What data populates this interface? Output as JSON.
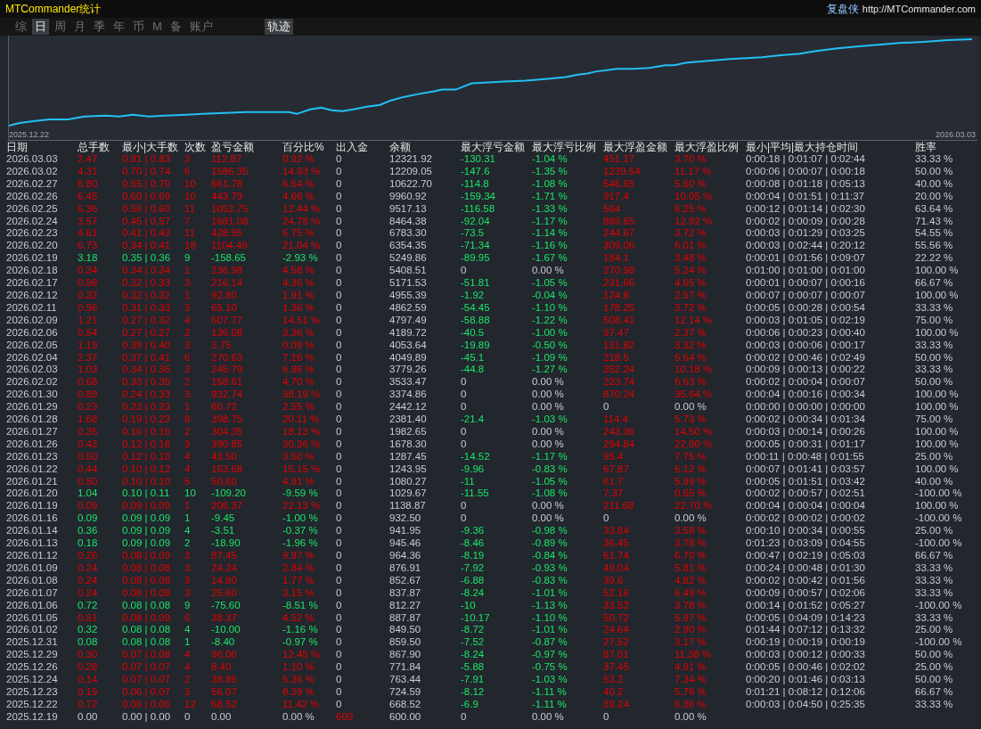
{
  "window": {
    "title": "MTCommander统计",
    "brand": "复盘侠",
    "url": "http://MTCommander.com"
  },
  "tabs": [
    {
      "label": "综",
      "selected": false
    },
    {
      "label": "日",
      "selected": true
    },
    {
      "label": "周",
      "selected": false
    },
    {
      "label": "月",
      "selected": false
    },
    {
      "label": "季",
      "selected": false
    },
    {
      "label": "年",
      "selected": false
    },
    {
      "label": "币",
      "selected": false
    },
    {
      "label": "M",
      "selected": false
    },
    {
      "label": "备",
      "selected": false
    },
    {
      "label": "账户",
      "selected": false
    }
  ],
  "view_tab": {
    "label": "轨迹",
    "selected": true
  },
  "chart": {
    "start_label": "2025.12.22",
    "end_label": "2026.03.03"
  },
  "columns": [
    "日期",
    "总手数",
    "最小|大手数",
    "次数",
    "盈亏金额",
    "百分比%",
    "出入金",
    "余额",
    "最大浮亏金额",
    "最大浮亏比例",
    "最大浮盈金额",
    "最大浮盈比例",
    "最小|平均|最大持仓时间",
    "胜率"
  ],
  "rows": [
    {
      "profit": true,
      "loss": false,
      "drawdown": true,
      "runup": true,
      "deposit": false,
      "cells": [
        "2026.03.03",
        "2.47",
        "0.81 | 0.83",
        "3",
        "112.87",
        "0.92 %",
        "0",
        "12321.92",
        "-130.31",
        "-1.04 %",
        "451.17",
        "3.70 %",
        "0:00:18 | 0:01:07 | 0:02:44",
        "33.33 %"
      ]
    },
    {
      "profit": true,
      "loss": false,
      "drawdown": true,
      "runup": true,
      "deposit": false,
      "cells": [
        "2026.03.02",
        "4.31",
        "0.70 | 0.74",
        "6",
        "1586.35",
        "14.93 %",
        "0",
        "12209.05",
        "-147.6",
        "-1.35 %",
        "1239.54",
        "11.17 %",
        "0:00:06 | 0:00:07 | 0:00:18",
        "50.00 %"
      ]
    },
    {
      "profit": true,
      "loss": false,
      "drawdown": true,
      "runup": true,
      "deposit": false,
      "cells": [
        "2026.02.27",
        "6.80",
        "0.65 | 0.70",
        "10",
        "661.78",
        "6.64 %",
        "0",
        "10622.70",
        "-114.8",
        "-1.08 %",
        "546.65",
        "5.60 %",
        "0:00:08 | 0:01:18 | 0:05:13",
        "40.00 %"
      ]
    },
    {
      "profit": true,
      "loss": false,
      "drawdown": true,
      "runup": true,
      "deposit": false,
      "cells": [
        "2026.02.26",
        "6.45",
        "0.60 | 0.69",
        "10",
        "443.79",
        "4.66 %",
        "0",
        "9960.92",
        "-159.34",
        "-1.71 %",
        "917.4",
        "10.05 %",
        "0:00:04 | 0:01:51 | 0:11:37",
        "20.00 %"
      ]
    },
    {
      "profit": true,
      "loss": false,
      "drawdown": true,
      "runup": true,
      "deposit": false,
      "cells": [
        "2026.02.25",
        "6.36",
        "0.56 | 0.60",
        "11",
        "1052.75",
        "12.44 %",
        "0",
        "9517.13",
        "-116.58",
        "-1.33 %",
        "564",
        "6.25 %",
        "0:00:12 | 0:01:14 | 0:02:30",
        "63.64 %"
      ]
    },
    {
      "profit": true,
      "loss": false,
      "drawdown": true,
      "runup": true,
      "deposit": false,
      "cells": [
        "2026.02.24",
        "3.57",
        "0.45 | 0.57",
        "7",
        "1681.08",
        "24.78 %",
        "0",
        "8464.38",
        "-92.04",
        "-1.17 %",
        "889.65",
        "12.92 %",
        "0:00:02 | 0:00:09 | 0:00:28",
        "71.43 %"
      ]
    },
    {
      "profit": true,
      "loss": false,
      "drawdown": true,
      "runup": true,
      "deposit": false,
      "cells": [
        "2026.02.23",
        "4.61",
        "0.41 | 0.43",
        "11",
        "428.95",
        "6.75 %",
        "0",
        "6783.30",
        "-73.5",
        "-1.14 %",
        "244.67",
        "3.72 %",
        "0:00:03 | 0:01:29 | 0:03:25",
        "54.55 %"
      ]
    },
    {
      "profit": true,
      "loss": false,
      "drawdown": true,
      "runup": true,
      "deposit": false,
      "cells": [
        "2026.02.20",
        "6.73",
        "0.34 | 0.41",
        "18",
        "1104.49",
        "21.04 %",
        "0",
        "6354.35",
        "-71.34",
        "-1.16 %",
        "309.06",
        "6.01 %",
        "0:00:03 | 0:02:44 | 0:20:12",
        "55.56 %"
      ]
    },
    {
      "profit": false,
      "loss": true,
      "drawdown": true,
      "runup": true,
      "deposit": false,
      "cells": [
        "2026.02.19",
        "3.18",
        "0.35 | 0.36",
        "9",
        "-158.65",
        "-2.93 %",
        "0",
        "5249.86",
        "-89.95",
        "-1.67 %",
        "184.1",
        "3.48 %",
        "0:00:01 | 0:01:56 | 0:09:07",
        "22.22 %"
      ]
    },
    {
      "profit": true,
      "loss": false,
      "drawdown": false,
      "runup": true,
      "deposit": false,
      "cells": [
        "2026.02.18",
        "0.34",
        "0.34 | 0.34",
        "1",
        "236.98",
        "4.58 %",
        "0",
        "5408.51",
        "0",
        "0.00 %",
        "270.98",
        "5.24 %",
        "0:01:00 | 0:01:00 | 0:01:00",
        "100.00 %"
      ]
    },
    {
      "profit": true,
      "loss": false,
      "drawdown": true,
      "runup": true,
      "deposit": false,
      "cells": [
        "2026.02.17",
        "0.98",
        "0.32 | 0.33",
        "3",
        "216.14",
        "4.36 %",
        "0",
        "5171.53",
        "-51.81",
        "-1.05 %",
        "231.66",
        "4.65 %",
        "0:00:01 | 0:00:07 | 0:00:16",
        "66.67 %"
      ]
    },
    {
      "profit": true,
      "loss": false,
      "drawdown": true,
      "runup": true,
      "deposit": false,
      "cells": [
        "2026.02.12",
        "0.32",
        "0.32 | 0.32",
        "1",
        "92.80",
        "1.91 %",
        "0",
        "4955.39",
        "-1.92",
        "-0.04 %",
        "124.8",
        "2.57 %",
        "0:00:07 | 0:00:07 | 0:00:07",
        "100.00 %"
      ]
    },
    {
      "profit": true,
      "loss": false,
      "drawdown": true,
      "runup": true,
      "deposit": false,
      "cells": [
        "2026.02.11",
        "0.96",
        "0.31 | 0.33",
        "3",
        "65.10",
        "1.36 %",
        "0",
        "4862.59",
        "-54.45",
        "-1.10 %",
        "178.25",
        "3.72 %",
        "0:00:05 | 0:00:28 | 0:00:54",
        "33.33 %"
      ]
    },
    {
      "profit": true,
      "loss": false,
      "drawdown": true,
      "runup": true,
      "deposit": false,
      "cells": [
        "2026.02.09",
        "1.21",
        "0.27 | 0.32",
        "4",
        "607.77",
        "14.51 %",
        "0",
        "4797.49",
        "-58.88",
        "-1.22 %",
        "508.41",
        "12.14 %",
        "0:00:03 | 0:01:05 | 0:02:19",
        "75.00 %"
      ]
    },
    {
      "profit": true,
      "loss": false,
      "drawdown": true,
      "runup": true,
      "deposit": false,
      "cells": [
        "2026.02.06",
        "0.54",
        "0.27 | 0.27",
        "2",
        "136.08",
        "3.36 %",
        "0",
        "4189.72",
        "-40.5",
        "-1.00 %",
        "97.47",
        "2.37 %",
        "0:00:06 | 0:00:23 | 0:00:40",
        "100.00 %"
      ]
    },
    {
      "profit": true,
      "loss": false,
      "drawdown": true,
      "runup": true,
      "deposit": false,
      "cells": [
        "2026.02.05",
        "1.19",
        "0.39 | 0.40",
        "3",
        "3.75",
        "0.09 %",
        "0",
        "4053.64",
        "-19.89",
        "-0.50 %",
        "131.82",
        "3.32 %",
        "0:00:03 | 0:00:06 | 0:00:17",
        "33.33 %"
      ]
    },
    {
      "profit": true,
      "loss": false,
      "drawdown": true,
      "runup": true,
      "deposit": false,
      "cells": [
        "2026.02.04",
        "2.37",
        "0.37 | 0.41",
        "6",
        "270.63",
        "7.16 %",
        "0",
        "4049.89",
        "-45.1",
        "-1.09 %",
        "218.5",
        "5.64 %",
        "0:00:02 | 0:00:46 | 0:02:49",
        "50.00 %"
      ]
    },
    {
      "profit": true,
      "loss": false,
      "drawdown": true,
      "runup": true,
      "deposit": false,
      "cells": [
        "2026.02.03",
        "1.03",
        "0.34 | 0.35",
        "3",
        "245.79",
        "6.96 %",
        "0",
        "3779.26",
        "-44.8",
        "-1.27 %",
        "352.24",
        "10.18 %",
        "0:00:09 | 0:00:13 | 0:00:22",
        "33.33 %"
      ]
    },
    {
      "profit": true,
      "loss": false,
      "drawdown": false,
      "runup": true,
      "deposit": false,
      "cells": [
        "2026.02.02",
        "0.68",
        "0.33 | 0.35",
        "2",
        "158.61",
        "4.70 %",
        "0",
        "3533.47",
        "0",
        "0.00 %",
        "223.74",
        "6.63 %",
        "0:00:02 | 0:00:04 | 0:00:07",
        "50.00 %"
      ]
    },
    {
      "profit": true,
      "loss": false,
      "drawdown": false,
      "runup": true,
      "deposit": false,
      "cells": [
        "2026.01.30",
        "0.89",
        "0.24 | 0.33",
        "3",
        "932.74",
        "38.19 %",
        "0",
        "3374.86",
        "0",
        "0.00 %",
        "870.24",
        "35.64 %",
        "0:00:04 | 0:00:16 | 0:00:34",
        "100.00 %"
      ]
    },
    {
      "profit": true,
      "loss": false,
      "drawdown": false,
      "runup": false,
      "deposit": false,
      "cells": [
        "2026.01.29",
        "0.23",
        "0.23 | 0.23",
        "1",
        "60.72",
        "2.55 %",
        "0",
        "2442.12",
        "0",
        "0.00 %",
        "0",
        "0.00 %",
        "0:00:00 | 0:00:00 | 0:00:00",
        "100.00 %"
      ]
    },
    {
      "profit": true,
      "loss": false,
      "drawdown": true,
      "runup": true,
      "deposit": false,
      "cells": [
        "2026.01.28",
        "1.68",
        "0.19 | 0.23",
        "8",
        "398.75",
        "20.11 %",
        "0",
        "2381.40",
        "-21.4",
        "-1.03 %",
        "114.4",
        "5.73 %",
        "0:00:02 | 0:00:34 | 0:01:34",
        "75.00 %"
      ]
    },
    {
      "profit": true,
      "loss": false,
      "drawdown": false,
      "runup": true,
      "deposit": false,
      "cells": [
        "2026.01.27",
        "0.35",
        "0.16 | 0.19",
        "2",
        "304.35",
        "18.13 %",
        "0",
        "1982.65",
        "0",
        "0.00 %",
        "243.36",
        "14.50 %",
        "0:00:03 | 0:00:14 | 0:00:26",
        "100.00 %"
      ]
    },
    {
      "profit": true,
      "loss": false,
      "drawdown": false,
      "runup": true,
      "deposit": false,
      "cells": [
        "2026.01.26",
        "0.43",
        "0.12 | 0.16",
        "3",
        "390.85",
        "30.36 %",
        "0",
        "1678.30",
        "0",
        "0.00 %",
        "294.84",
        "22.90 %",
        "0:00:05 | 0:00:31 | 0:01:17",
        "100.00 %"
      ]
    },
    {
      "profit": true,
      "loss": false,
      "drawdown": true,
      "runup": true,
      "deposit": false,
      "cells": [
        "2026.01.23",
        "0.50",
        "0.12 | 0.13",
        "4",
        "43.50",
        "3.50 %",
        "0",
        "1287.45",
        "-14.52",
        "-1.17 %",
        "95.4",
        "7.75 %",
        "0:00:11 | 0:00:48 | 0:01:55",
        "25.00 %"
      ]
    },
    {
      "profit": true,
      "loss": false,
      "drawdown": true,
      "runup": true,
      "deposit": false,
      "cells": [
        "2026.01.22",
        "0.44",
        "0.10 | 0.12",
        "4",
        "163.68",
        "15.15 %",
        "0",
        "1243.95",
        "-9.96",
        "-0.83 %",
        "67.87",
        "6.12 %",
        "0:00:07 | 0:01:41 | 0:03:57",
        "100.00 %"
      ]
    },
    {
      "profit": true,
      "loss": false,
      "drawdown": true,
      "runup": true,
      "deposit": false,
      "cells": [
        "2026.01.21",
        "0.50",
        "0.10 | 0.10",
        "5",
        "50.60",
        "4.91 %",
        "0",
        "1080.27",
        "-11",
        "-1.05 %",
        "61.7",
        "5.99 %",
        "0:00:05 | 0:01:51 | 0:03:42",
        "40.00 %"
      ]
    },
    {
      "profit": false,
      "loss": true,
      "drawdown": true,
      "runup": true,
      "deposit": false,
      "cells": [
        "2026.01.20",
        "1.04",
        "0.10 | 0.11",
        "10",
        "-109.20",
        "-9.59 %",
        "0",
        "1029.67",
        "-11.55",
        "-1.08 %",
        "7.37",
        "0.65 %",
        "0:00:02 | 0:00:57 | 0:02:51",
        "-100.00 %"
      ]
    },
    {
      "profit": true,
      "loss": false,
      "drawdown": false,
      "runup": true,
      "deposit": false,
      "cells": [
        "2026.01.19",
        "0.09",
        "0.09 | 0.09",
        "1",
        "206.37",
        "22.13 %",
        "0",
        "1138.87",
        "0",
        "0.00 %",
        "211.68",
        "22.70 %",
        "0:00:04 | 0:00:04 | 0:00:04",
        "100.00 %"
      ]
    },
    {
      "profit": false,
      "loss": true,
      "drawdown": false,
      "runup": false,
      "deposit": false,
      "cells": [
        "2026.01.16",
        "0.09",
        "0.09 | 0.09",
        "1",
        "-9.45",
        "-1.00 %",
        "0",
        "932.50",
        "0",
        "0.00 %",
        "0",
        "0.00 %",
        "0:00:02 | 0:00:02 | 0:00:02",
        "-100.00 %"
      ]
    },
    {
      "profit": false,
      "loss": true,
      "drawdown": true,
      "runup": true,
      "deposit": false,
      "cells": [
        "2026.01.14",
        "0.36",
        "0.09 | 0.09",
        "4",
        "-3.51",
        "-0.37 %",
        "0",
        "941.95",
        "-9.36",
        "-0.98 %",
        "33.84",
        "3.58 %",
        "0:00:10 | 0:00:34 | 0:00:55",
        "25.00 %"
      ]
    },
    {
      "profit": false,
      "loss": true,
      "drawdown": true,
      "runup": true,
      "deposit": false,
      "cells": [
        "2026.01.13",
        "0.18",
        "0.09 | 0.09",
        "2",
        "-18.90",
        "-1.96 %",
        "0",
        "945.46",
        "-8.46",
        "-0.89 %",
        "36.45",
        "3.78 %",
        "0:01:23 | 0:03:09 | 0:04:55",
        "-100.00 %"
      ]
    },
    {
      "profit": true,
      "loss": false,
      "drawdown": true,
      "runup": true,
      "deposit": false,
      "cells": [
        "2026.01.12",
        "0.26",
        "0.08 | 0.09",
        "3",
        "87.45",
        "9.97 %",
        "0",
        "964.36",
        "-8.19",
        "-0.84 %",
        "61.74",
        "6.70 %",
        "0:00:47 | 0:02:19 | 0:05:03",
        "66.67 %"
      ]
    },
    {
      "profit": true,
      "loss": false,
      "drawdown": true,
      "runup": true,
      "deposit": false,
      "cells": [
        "2026.01.09",
        "0.24",
        "0.08 | 0.08",
        "3",
        "24.24",
        "2.84 %",
        "0",
        "876.91",
        "-7.92",
        "-0.93 %",
        "49.04",
        "5.81 %",
        "0:00:24 | 0:00:48 | 0:01:30",
        "33.33 %"
      ]
    },
    {
      "profit": true,
      "loss": false,
      "drawdown": true,
      "runup": true,
      "deposit": false,
      "cells": [
        "2026.01.08",
        "0.24",
        "0.08 | 0.08",
        "3",
        "14.80",
        "1.77 %",
        "0",
        "852.67",
        "-6.88",
        "-0.83 %",
        "39.6",
        "4.82 %",
        "0:00:02 | 0:00:42 | 0:01:56",
        "33.33 %"
      ]
    },
    {
      "profit": true,
      "loss": false,
      "drawdown": true,
      "runup": true,
      "deposit": false,
      "cells": [
        "2026.01.07",
        "0.24",
        "0.08 | 0.08",
        "3",
        "25.60",
        "3.15 %",
        "0",
        "837.87",
        "-8.24",
        "-1.01 %",
        "52.16",
        "6.49 %",
        "0:00:09 | 0:00:57 | 0:02:06",
        "33.33 %"
      ]
    },
    {
      "profit": false,
      "loss": true,
      "drawdown": true,
      "runup": true,
      "deposit": false,
      "cells": [
        "2026.01.06",
        "0.72",
        "0.08 | 0.08",
        "9",
        "-75.60",
        "-8.51 %",
        "0",
        "812.27",
        "-10",
        "-1.13 %",
        "33.52",
        "3.78 %",
        "0:00:14 | 0:01:52 | 0:05:27",
        "-100.00 %"
      ]
    },
    {
      "profit": true,
      "loss": false,
      "drawdown": true,
      "runup": true,
      "deposit": false,
      "cells": [
        "2026.01.05",
        "0.51",
        "0.08 | 0.09",
        "6",
        "38.37",
        "4.52 %",
        "0",
        "887.87",
        "-10.17",
        "-1.10 %",
        "50.72",
        "5.97 %",
        "0:00:05 | 0:04:09 | 0:14:23",
        "33.33 %"
      ]
    },
    {
      "profit": false,
      "loss": true,
      "drawdown": true,
      "runup": true,
      "deposit": false,
      "cells": [
        "2026.01.02",
        "0.32",
        "0.08 | 0.08",
        "4",
        "-10.00",
        "-1.16 %",
        "0",
        "849.50",
        "-8.72",
        "-1.01 %",
        "24.64",
        "2.90 %",
        "0:01:44 | 0:07:12 | 0:13:32",
        "25.00 %"
      ]
    },
    {
      "profit": false,
      "loss": true,
      "drawdown": true,
      "runup": true,
      "deposit": false,
      "cells": [
        "2025.12.31",
        "0.08",
        "0.08 | 0.08",
        "1",
        "-8.40",
        "-0.97 %",
        "0",
        "859.50",
        "-7.52",
        "-0.87 %",
        "27.52",
        "3.17 %",
        "0:00:19 | 0:00:19 | 0:00:19",
        "-100.00 %"
      ]
    },
    {
      "profit": true,
      "loss": false,
      "drawdown": true,
      "runup": true,
      "deposit": false,
      "cells": [
        "2025.12.29",
        "0.30",
        "0.07 | 0.08",
        "4",
        "96.06",
        "12.45 %",
        "0",
        "867.90",
        "-8.24",
        "-0.97 %",
        "87.01",
        "11.38 %",
        "0:00:03 | 0:00:12 | 0:00:33",
        "50.00 %"
      ]
    },
    {
      "profit": true,
      "loss": false,
      "drawdown": true,
      "runup": true,
      "deposit": false,
      "cells": [
        "2025.12.26",
        "0.28",
        "0.07 | 0.07",
        "4",
        "8.40",
        "1.10 %",
        "0",
        "771.84",
        "-5.88",
        "-0.75 %",
        "37.45",
        "4.91 %",
        "0:00:05 | 0:00:46 | 0:02:02",
        "25.00 %"
      ]
    },
    {
      "profit": true,
      "loss": false,
      "drawdown": true,
      "runup": true,
      "deposit": false,
      "cells": [
        "2025.12.24",
        "0.14",
        "0.07 | 0.07",
        "2",
        "38.85",
        "5.36 %",
        "0",
        "763.44",
        "-7.91",
        "-1.03 %",
        "53.2",
        "7.34 %",
        "0:00:20 | 0:01:46 | 0:03:13",
        "50.00 %"
      ]
    },
    {
      "profit": true,
      "loss": false,
      "drawdown": true,
      "runup": true,
      "deposit": false,
      "cells": [
        "2025.12.23",
        "0.19",
        "0.06 | 0.07",
        "3",
        "56.07",
        "8.39 %",
        "0",
        "724.59",
        "-8.12",
        "-1.11 %",
        "40.2",
        "5.76 %",
        "0:01:21 | 0:08:12 | 0:12:06",
        "66.67 %"
      ]
    },
    {
      "profit": true,
      "loss": false,
      "drawdown": true,
      "runup": true,
      "deposit": false,
      "cells": [
        "2025.12.22",
        "0.72",
        "0.06 | 0.06",
        "12",
        "68.52",
        "11.42 %",
        "0",
        "668.52",
        "-6.9",
        "-1.11 %",
        "39.24",
        "6.36 %",
        "0:00:03 | 0:04:50 | 0:25:35",
        "33.33 %"
      ]
    },
    {
      "profit": false,
      "loss": false,
      "drawdown": false,
      "runup": false,
      "deposit": true,
      "cells": [
        "2025.12.19",
        "0.00",
        "0.00 | 0.00",
        "0",
        "0.00",
        "0.00 %",
        "600",
        "600.00",
        "0",
        "0.00 %",
        "0",
        "0.00 %"
      ]
    }
  ]
}
